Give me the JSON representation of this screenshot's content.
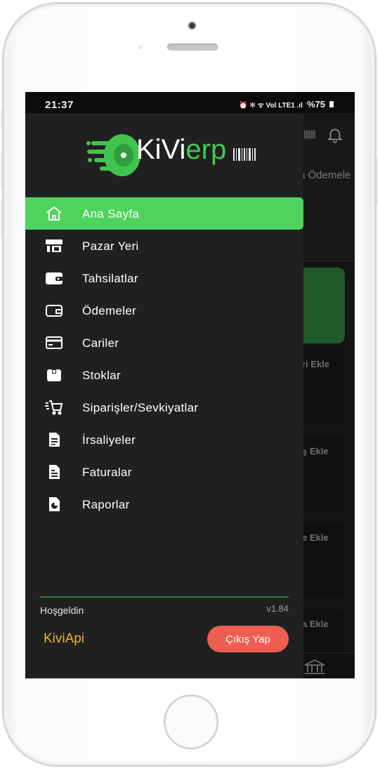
{
  "status_bar": {
    "time": "21:37",
    "indicators": "⏰ ✻ ᯤ Vol LTE1 .ıl",
    "battery": "%75"
  },
  "app": {
    "logo_brand": "KiVi",
    "logo_suffix": "erp",
    "accent_color": "#4ed35c",
    "logout_color": "#ee5d50"
  },
  "menu": {
    "items": [
      {
        "label": "Ana Sayfa",
        "icon": "home-icon",
        "active": true
      },
      {
        "label": "Pazar Yeri",
        "icon": "store-icon",
        "active": false
      },
      {
        "label": "Tahsilatlar",
        "icon": "wallet-icon",
        "active": false
      },
      {
        "label": "Ödemeler",
        "icon": "wallet-outline-icon",
        "active": false
      },
      {
        "label": "Cariler",
        "icon": "credit-card-icon",
        "active": false
      },
      {
        "label": "Stoklar",
        "icon": "box-icon",
        "active": false
      },
      {
        "label": "Siparişler/Sevkiyatlar",
        "icon": "cart-icon",
        "active": false
      },
      {
        "label": "İrsaliyeler",
        "icon": "document-icon",
        "active": false
      },
      {
        "label": "Faturalar",
        "icon": "invoice-icon",
        "active": false
      },
      {
        "label": "Raporlar",
        "icon": "report-icon",
        "active": false
      }
    ]
  },
  "footer": {
    "welcome": "Hoşgeldin",
    "version": "v1.84",
    "username": "KiviApi",
    "logout_label": "Çıkış Yap"
  },
  "background_screen": {
    "tab_text": "a Ödemele",
    "card_labels": [
      "ri Ekle",
      "ş Ekle",
      "e Ekle",
      "a Ekle"
    ]
  }
}
